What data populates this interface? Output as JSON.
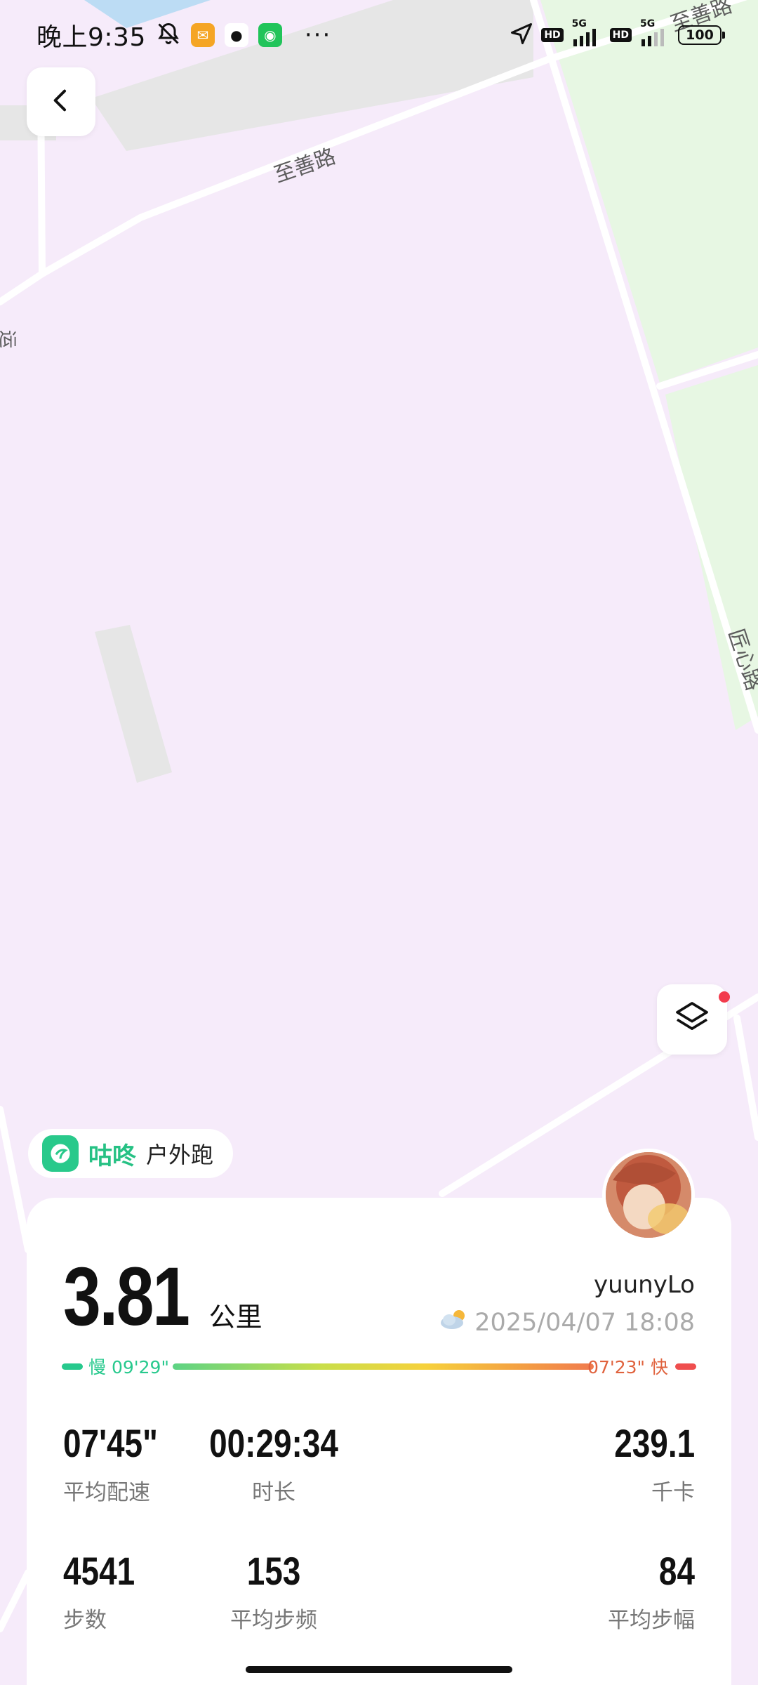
{
  "status_bar": {
    "time": "晚上9:35",
    "icons": [
      "bell-off-icon",
      "mail-app-icon",
      "qq-app-icon",
      "wechat-app-icon"
    ],
    "more": "···",
    "signal_label_1": "5G",
    "signal_label_2": "5G",
    "hd_label": "HD",
    "battery": "100"
  },
  "map": {
    "road_labels": [
      "至善路",
      "至善路",
      "匠心路",
      "运"
    ]
  },
  "brand": {
    "name": "咕咚",
    "activity": "户外跑",
    "color": "#26c184"
  },
  "summary": {
    "distance": "3.81",
    "distance_unit": "公里",
    "username": "yuunyLo",
    "datetime": "2025/04/07 18:08",
    "weather_icon": "partly-cloudy-icon"
  },
  "pace_bar": {
    "slow_label": "慢 09'29\"",
    "fast_label": "07'23\" 快"
  },
  "stats": [
    {
      "value": "07'45\"",
      "label": "平均配速"
    },
    {
      "value": "00:29:34",
      "label": "时长"
    },
    {
      "value": "239.1",
      "label": "千卡"
    },
    {
      "value": "4541",
      "label": "步数"
    },
    {
      "value": "153",
      "label": "平均步频"
    },
    {
      "value": "84",
      "label": "平均步幅"
    }
  ]
}
